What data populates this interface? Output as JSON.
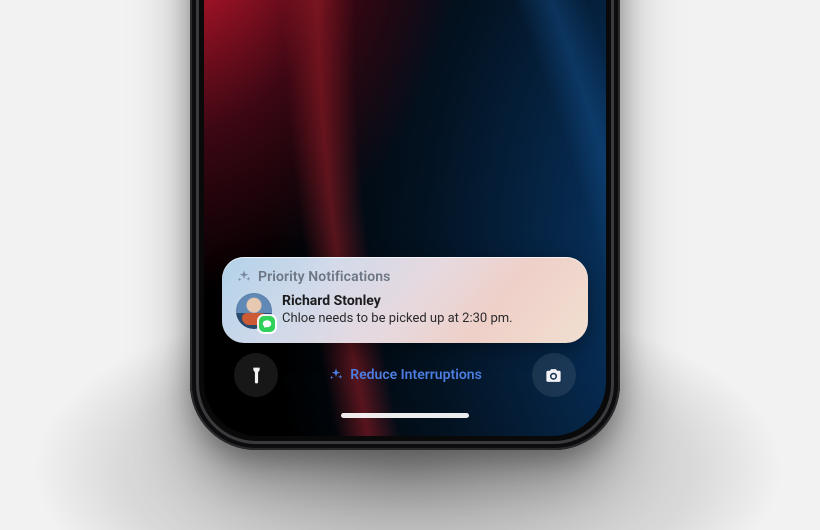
{
  "notification_card": {
    "header_label": "Priority Notifications",
    "item": {
      "contact_name": "Richard Stonley",
      "message": "Chloe needs to be picked up at 2:30 pm.",
      "app_badge_name": "messages-app-icon"
    }
  },
  "bottom_row": {
    "flashlight_label": "Flashlight",
    "camera_label": "Camera",
    "focus_label": "Reduce Interruptions"
  },
  "colors": {
    "focus_accent": "#4c7de0",
    "messages_green": "#30d158"
  }
}
